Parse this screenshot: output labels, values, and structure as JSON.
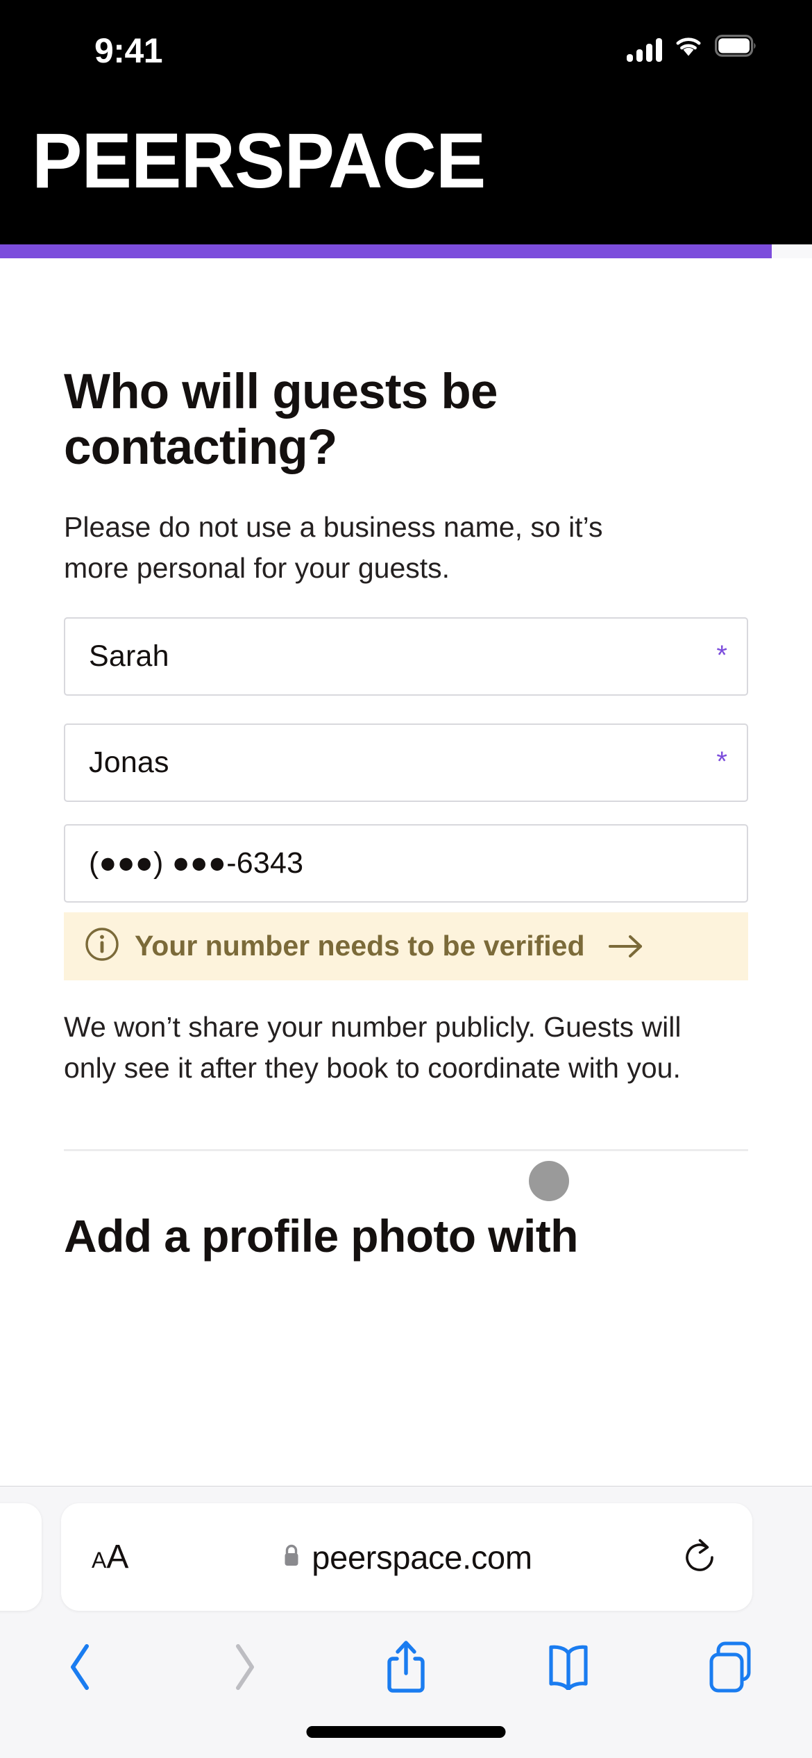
{
  "status_bar": {
    "time": "9:41",
    "cellular_icon": "cellular-signal-icon",
    "wifi_icon": "wifi-icon",
    "battery_icon": "battery-full-icon",
    "background_color": "#000000"
  },
  "site_header": {
    "brand": "PEERSPACE",
    "background_color": "#000000",
    "text_color": "#ffffff"
  },
  "progress": {
    "percent": 95,
    "fill_color": "#7c4ddc",
    "track_color": "#f8f8fa"
  },
  "main": {
    "heading": "Who will guests be contacting?",
    "subheading": "Please do not use a business name, so it’s more personal for your guests.",
    "fields": [
      {
        "name": "first-name",
        "value": "Sarah",
        "required_marker": "*",
        "required_color": "#7c4ddc"
      },
      {
        "name": "last-name",
        "value": "Jonas",
        "required_marker": "*",
        "required_color": "#7c4ddc"
      },
      {
        "name": "phone-number",
        "value": "(●●●) ●●●-6343",
        "required_marker": "",
        "required_color": "#7c4ddc"
      }
    ],
    "verify_banner": {
      "icon": "info-circle-icon",
      "text": "Your number needs to be verified",
      "arrow_icon": "arrow-right-icon",
      "background_color": "#fdf3dc",
      "text_color": "#7b6a39"
    },
    "privacy_note": "We won’t share your number publicly. Guests will only see it after they book to coordinate with you.",
    "next_section_heading": "Add a profile photo with"
  },
  "overlay": {
    "touch_indicator": "touch-point-indicator",
    "color": "#9a9a9a"
  },
  "browser": {
    "url": "peerspace.com",
    "lock_icon": "lock-icon",
    "text_size_small": "A",
    "text_size_big": "A",
    "reload_icon": "reload-icon",
    "toolbar": [
      {
        "name": "back-button",
        "icon": "chevron-left-icon",
        "enabled": true
      },
      {
        "name": "forward-button",
        "icon": "chevron-right-icon",
        "enabled": false
      },
      {
        "name": "share-button",
        "icon": "share-icon",
        "enabled": true
      },
      {
        "name": "bookmarks-button",
        "icon": "book-icon",
        "enabled": true
      },
      {
        "name": "tabs-button",
        "icon": "tabs-icon",
        "enabled": true
      }
    ],
    "accent_color": "#1a7cf0",
    "disabled_color": "#bdbdc2",
    "bar_background": "#f6f6f8"
  }
}
